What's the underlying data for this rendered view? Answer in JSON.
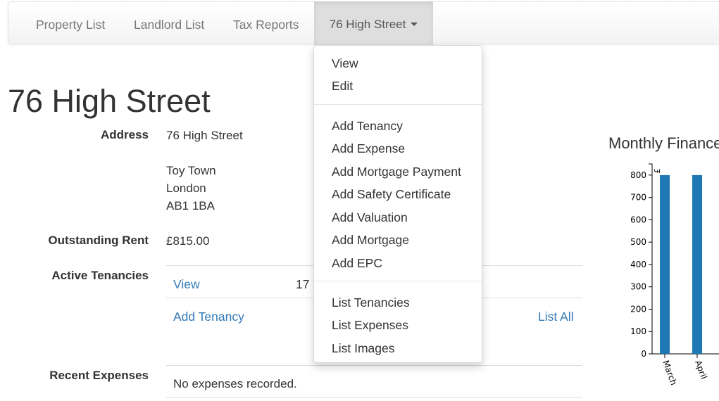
{
  "navbar": {
    "items": [
      {
        "label": "Property List"
      },
      {
        "label": "Landlord List"
      },
      {
        "label": "Tax Reports"
      }
    ],
    "active_label": "76 High Street"
  },
  "page": {
    "title": "76 High Street",
    "address_label": "Address",
    "address_lines": [
      "76 High Street",
      "",
      "Toy Town",
      "London",
      "AB1 1BA"
    ],
    "outstanding_rent_label": "Outstanding Rent",
    "outstanding_rent_value": "£815.00",
    "active_tenancies_label": "Active Tenancies",
    "tenancy_row": {
      "link": "View",
      "value": "17"
    },
    "add_tenancy_link": "Add Tenancy",
    "list_all_link": "List All",
    "recent_expenses_label": "Recent Expenses",
    "no_expenses_text": "No expenses recorded."
  },
  "dropdown": {
    "groups": [
      [
        "View",
        "Edit"
      ],
      [
        "Add Tenancy",
        "Add Expense",
        "Add Mortgage Payment",
        "Add Safety Certificate",
        "Add Valuation",
        "Add Mortgage",
        "Add EPC"
      ],
      [
        "List Tenancies",
        "List Expenses",
        "List Images"
      ]
    ]
  },
  "chart_data": {
    "type": "bar",
    "title": "Monthly Finance",
    "ylabel": "£",
    "categories": [
      "March",
      "April"
    ],
    "series": [
      {
        "values": [
          800,
          800
        ]
      }
    ],
    "ylim": [
      0,
      850
    ],
    "yticks": [
      0,
      100,
      200,
      300,
      400,
      500,
      600,
      700,
      800
    ],
    "bar_color": "#1f77b4"
  }
}
